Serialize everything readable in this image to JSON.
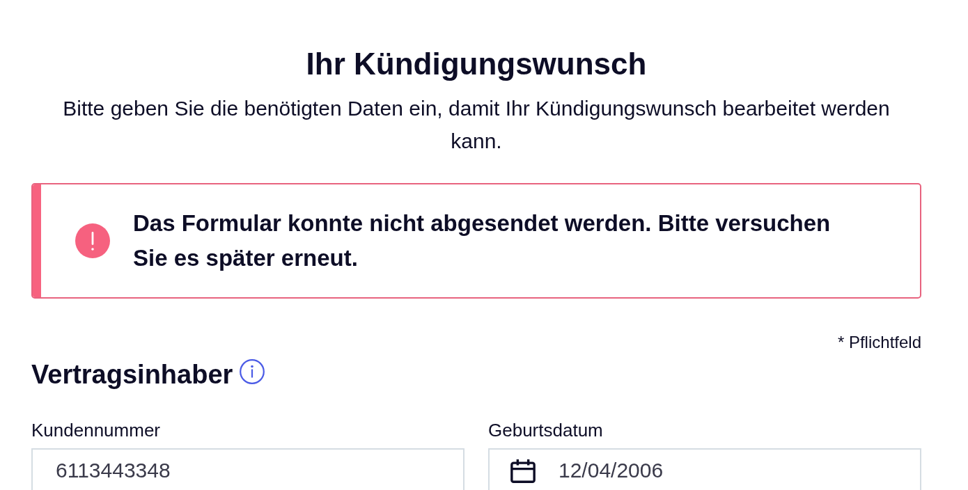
{
  "page": {
    "title": "Ihr Kündigungswunsch",
    "intro": "Bitte geben Sie die benötigten Daten ein, damit Ihr Kündigungswunsch bearbeitet werden kann."
  },
  "alert": {
    "kind": "error",
    "message": "Das Formular konnte nicht abgesendet werden. Bitte versuchen Sie es später erneut."
  },
  "required_note": "* Pflichtfeld",
  "section": {
    "title": "Vertragsinhaber"
  },
  "fields": [
    {
      "kind": "text",
      "label": "Kundennummer",
      "value": "6113443348"
    },
    {
      "kind": "date",
      "label": "Geburtsdatum",
      "value": "12/04/2006"
    }
  ]
}
